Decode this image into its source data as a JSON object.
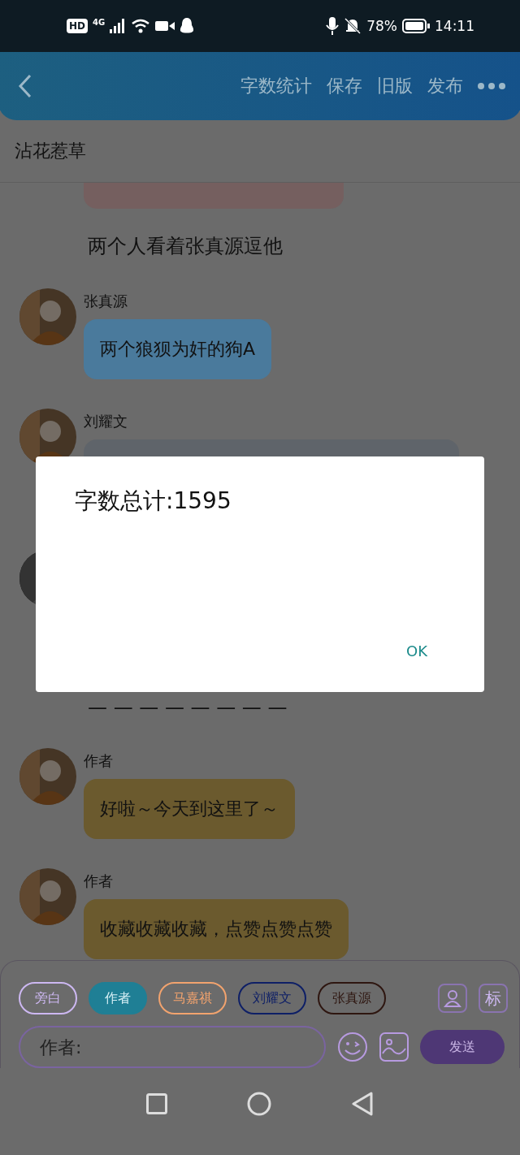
{
  "status_bar": {
    "hd": "HD",
    "network": "4G",
    "battery": "78%",
    "time": "14:11"
  },
  "header": {
    "actions": [
      "字数统计",
      "保存",
      "旧版",
      "发布"
    ]
  },
  "story_title": "沾花惹草",
  "messages": [
    {
      "kind": "bubble_cut",
      "color": "#755f5f"
    },
    {
      "kind": "narration",
      "text": "两个人看着张真源逗他"
    },
    {
      "kind": "message",
      "name": "张真源",
      "text": "两个狼狈为奸的狗A",
      "color": "#4a7a9c"
    },
    {
      "kind": "message",
      "name": "刘耀文",
      "color": "#5f646a"
    },
    {
      "kind": "avatar_only"
    },
    {
      "kind": "narration",
      "text": "— — — — — — — —"
    },
    {
      "kind": "message",
      "name": "作者",
      "text": "好啦～今天到这里了～",
      "color": "#6b5a2e"
    },
    {
      "kind": "message",
      "name": "作者",
      "text": "收藏收藏收藏，点赞点赞点赞",
      "color": "#6b5a2e"
    }
  ],
  "roles": [
    {
      "label": "旁白",
      "color": "#cdb8f2",
      "selected": false
    },
    {
      "label": "作者",
      "color": "#1f7f95",
      "selected": true
    },
    {
      "label": "马嘉祺",
      "color": "#f2a36e",
      "selected": false
    },
    {
      "label": "刘耀文",
      "color": "#0e1f66",
      "selected": false
    },
    {
      "label": "张真源",
      "color": "#2e1610",
      "selected": false
    }
  ],
  "tag_button": "标",
  "input": {
    "placeholder": "作者:"
  },
  "send_button": "发送",
  "dialog": {
    "message": "字数总计:1595",
    "button": "OK"
  }
}
